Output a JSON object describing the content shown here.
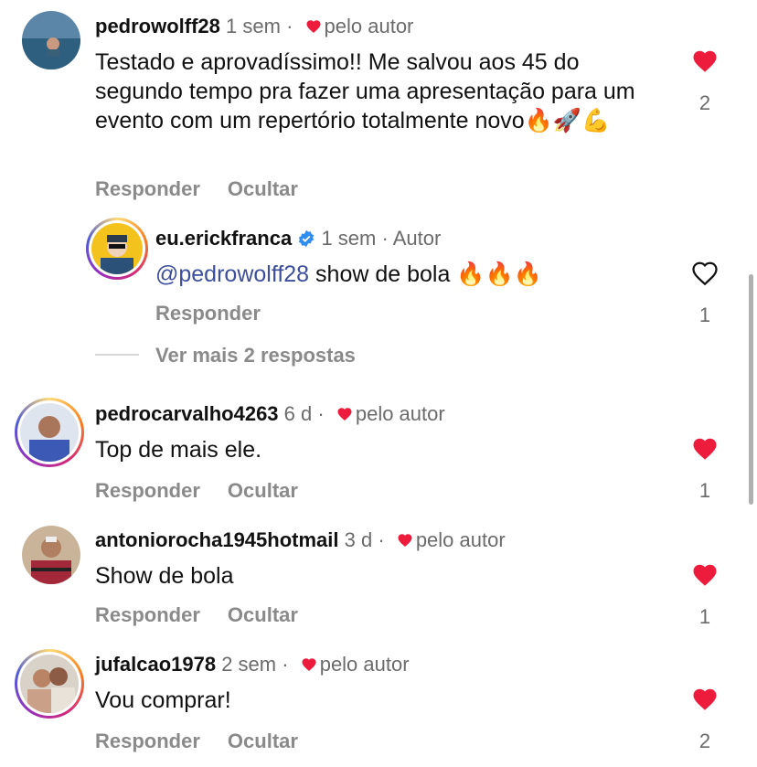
{
  "comments": [
    {
      "user": "pedrowolff28",
      "time": "1 sem",
      "sep": "·",
      "liked_by_author": "pelo autor",
      "text": "Testado e aprovadíssimo!! Me salvou aos 45 do segundo tempo pra fazer uma apresentação para um evento com um repertório totalmente novo",
      "emojis": "🔥🚀💪",
      "reply_label": "Responder",
      "hide_label": "Ocultar",
      "likes": "2",
      "liked": true
    },
    {
      "user": "pedrocarvalho4263",
      "time": "6 d",
      "sep": "·",
      "liked_by_author": "pelo autor",
      "text": "Top de mais ele.",
      "reply_label": "Responder",
      "hide_label": "Ocultar",
      "likes": "1",
      "liked": true
    },
    {
      "user": "antoniorocha1945hotmail",
      "time": "3 d",
      "sep": "·",
      "liked_by_author": "pelo autor",
      "text": "Show de bola",
      "reply_label": "Responder",
      "hide_label": "Ocultar",
      "likes": "1",
      "liked": true
    },
    {
      "user": "jufalcao1978",
      "time": "2 sem",
      "sep": "·",
      "liked_by_author": "pelo autor",
      "text": "Vou comprar!",
      "reply_label": "Responder",
      "hide_label": "Ocultar",
      "likes": "2",
      "liked": true
    }
  ],
  "reply": {
    "user": "eu.erickfranca",
    "verified": true,
    "time": "1 sem",
    "sep": "·",
    "role": "Autor",
    "mention": "@pedrowolff28",
    "text": "show de bola",
    "emojis": "🔥🔥🔥",
    "reply_label": "Responder",
    "likes": "1",
    "liked": false
  },
  "more_replies": "Ver mais 2 respostas",
  "colors": {
    "heart": "#ed1c3c",
    "username": "#111111",
    "meta": "#6b6b6b",
    "action": "#8a8a8a",
    "mention": "#3d4f9c",
    "verified": "#2f8cf0"
  },
  "icons": {
    "liked": "heart-filled-icon",
    "not_liked": "heart-outline-icon",
    "verified": "verified-badge-icon"
  }
}
